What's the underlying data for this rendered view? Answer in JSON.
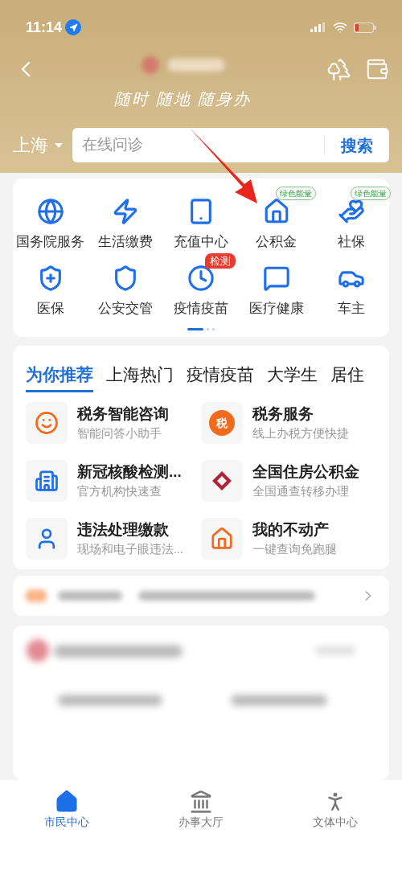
{
  "status_bar": {
    "time": "11:14"
  },
  "header": {
    "slogan": "随时 随地 随身办",
    "city": "上海",
    "search": {
      "placeholder": "在线问诊",
      "button": "搜索"
    }
  },
  "services": [
    {
      "label": "国务院服务"
    },
    {
      "label": "生活缴费"
    },
    {
      "label": "充值中心"
    },
    {
      "label": "公积金",
      "badge": {
        "text": "绿色能量",
        "kind": "green"
      }
    },
    {
      "label": "社保",
      "badge": {
        "text": "绿色能量",
        "kind": "green"
      }
    },
    {
      "label": "医保"
    },
    {
      "label": "公安交管"
    },
    {
      "label": "疫情疫苗",
      "badge": {
        "text": "检测",
        "kind": "red"
      }
    },
    {
      "label": "医疗健康"
    },
    {
      "label": "车主"
    }
  ],
  "pager": [
    {
      "selected": true
    },
    {
      "selected": false
    },
    {
      "selected": false
    }
  ],
  "recommend": {
    "tabs": [
      {
        "label": "为你推荐",
        "selected": true
      },
      {
        "label": "上海热门",
        "selected": false
      },
      {
        "label": "疫情疫苗",
        "selected": false
      },
      {
        "label": "大学生",
        "selected": false
      },
      {
        "label": "居住",
        "selected": false
      }
    ],
    "items": [
      {
        "title": "税务智能咨询",
        "subtitle": "智能问答小助手"
      },
      {
        "title": "税务服务",
        "subtitle": "线上办税方便快捷",
        "icon_text": "税"
      },
      {
        "title": "新冠核酸检测...",
        "subtitle": "官方机构快速查"
      },
      {
        "title": "全国住房公积金",
        "subtitle": "全国通查转移办理"
      },
      {
        "title": "违法处理缴款",
        "subtitle": "现场和电子眼违法..."
      },
      {
        "title": "我的不动产",
        "subtitle": "一键查询免跑腿"
      }
    ]
  },
  "tab_bar": [
    {
      "label": "市民中心",
      "selected": true
    },
    {
      "label": "办事大厅",
      "selected": false
    },
    {
      "label": "文体中心",
      "selected": false
    }
  ]
}
